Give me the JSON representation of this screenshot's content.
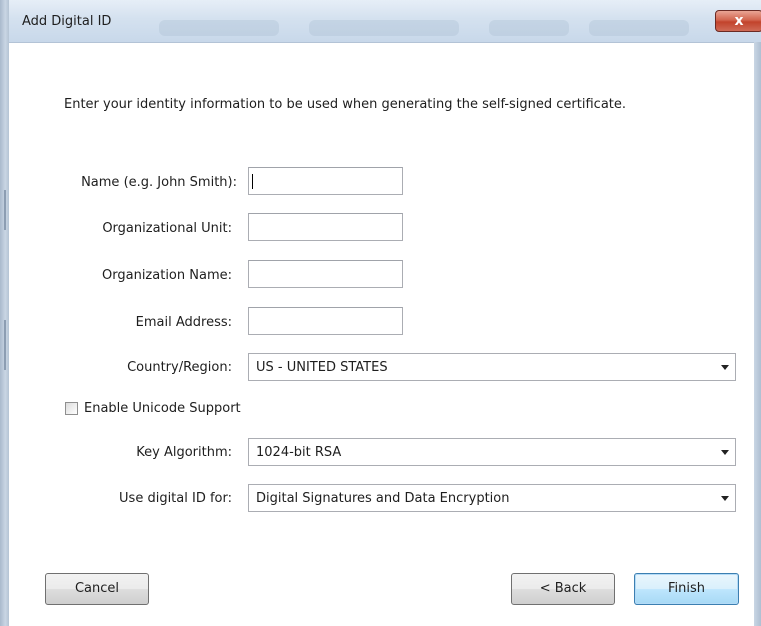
{
  "window": {
    "title": "Add Digital ID",
    "close_label": "x"
  },
  "prompt": "Enter your identity information to be used when generating the self-signed certificate.",
  "fields": {
    "name": {
      "label": "Name (e.g. John Smith):",
      "value": ""
    },
    "org_unit": {
      "label": "Organizational Unit:",
      "value": ""
    },
    "org_name": {
      "label": "Organization Name:",
      "value": ""
    },
    "email": {
      "label": "Email Address:",
      "value": ""
    }
  },
  "country": {
    "label": "Country/Region:",
    "value": "US - UNITED STATES"
  },
  "unicode": {
    "label": "Enable Unicode Support",
    "checked": false
  },
  "key_algorithm": {
    "label": "Key Algorithm:",
    "value": "1024-bit RSA"
  },
  "usage": {
    "label": "Use digital ID for:",
    "value": "Digital Signatures and Data Encryption"
  },
  "buttons": {
    "cancel": "Cancel",
    "back": "< Back",
    "finish": "Finish"
  },
  "colors": {
    "titlebar": "#d4e1ef",
    "close_button": "#c2432c",
    "default_button_border": "#3c7fb1",
    "field_border": "#abadb3"
  },
  "icons": {
    "close": "close-icon",
    "dropdown": "chevron-down-icon",
    "checkbox": "checkbox-unchecked"
  }
}
